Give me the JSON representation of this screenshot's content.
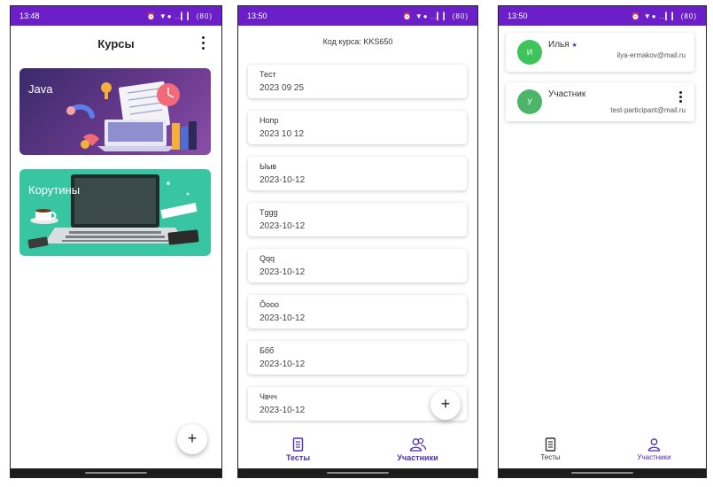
{
  "screen1": {
    "status": {
      "time": "13:48",
      "icons": "⏰ ▼● ..▎▎ (80)"
    },
    "title": "Курсы",
    "courses": [
      {
        "label": "Java",
        "color": "#5a3a8a"
      },
      {
        "label": "Корутины",
        "color": "#37c5a2"
      }
    ],
    "fab": "+"
  },
  "screen2": {
    "status": {
      "time": "13:50",
      "icons": "⏰ ▼● ..▎▎ (80)"
    },
    "course_code": "Код курса: KKS650",
    "tests": [
      {
        "title": "Тест",
        "date": "2023 09 25"
      },
      {
        "title": "Нопр",
        "date": "2023 10 12"
      },
      {
        "title": "Ыыв",
        "date": "2023-10-12"
      },
      {
        "title": "Тggg",
        "date": "2023-10-12"
      },
      {
        "title": "Qqq",
        "date": "2023-10-12"
      },
      {
        "title": "Ôooo",
        "date": "2023-10-12"
      },
      {
        "title": "Ббб",
        "date": "2023-10-12"
      },
      {
        "title": "Чвчч",
        "date": "2023-10-12"
      }
    ],
    "fab": "+",
    "nav": {
      "tests": "Тесты",
      "participants": "Участники"
    }
  },
  "screen3": {
    "status": {
      "time": "13:50",
      "icons": "⏰ ▼● ..▎▎ (80)"
    },
    "members": [
      {
        "initial": "И",
        "name": "Илья",
        "badge": "★",
        "email": "ilya-ermakov@mail.ru",
        "avatar_color": "#3ec45a"
      },
      {
        "initial": "У",
        "name": "Участник",
        "badge": "",
        "email": "test-participant@mail.ru",
        "avatar_color": "#4cb56a"
      }
    ],
    "nav": {
      "tests": "Тесты",
      "participants": "Участники"
    }
  },
  "colors": {
    "status_bar": "#6a1fc8",
    "nav_accent": "#4b2fb0"
  }
}
